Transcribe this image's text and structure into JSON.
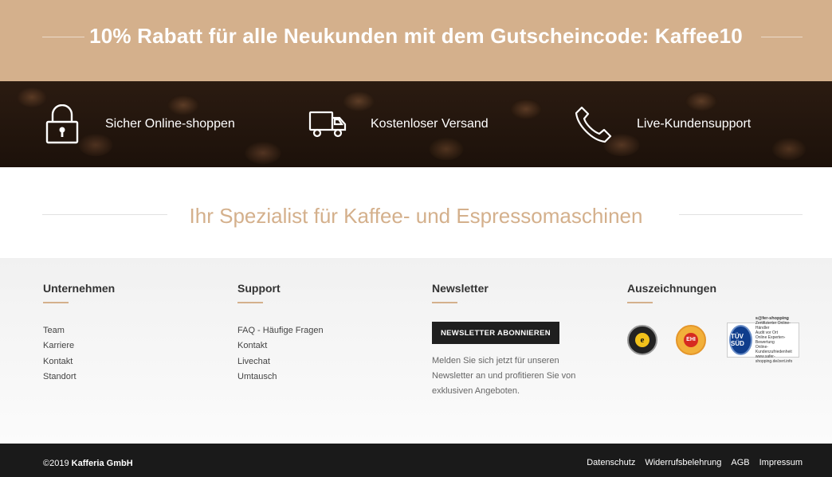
{
  "promo": {
    "text": "10% Rabatt für alle Neukunden mit dem Gutscheincode: Kaffee10"
  },
  "features": [
    {
      "icon": "lock-icon",
      "label": "Sicher Online-shoppen"
    },
    {
      "icon": "truck-icon",
      "label": "Kostenloser Versand"
    },
    {
      "icon": "phone-icon",
      "label": "Live-Kundensupport"
    }
  ],
  "tagline": {
    "text": "Ihr Spezialist für Kaffee- und Espressomaschinen"
  },
  "footer": {
    "company": {
      "title": "Unternehmen",
      "links": [
        "Team",
        "Karriere",
        "Kontakt",
        "Standort"
      ]
    },
    "support": {
      "title": "Support",
      "links": [
        "FAQ - Häufige Fragen",
        "Kontakt",
        "Livechat",
        "Umtausch"
      ]
    },
    "newsletter": {
      "title": "Newsletter",
      "button_label": "NEWSLETTER ABONNIEREN",
      "description": "Melden Sie sich jetzt für unseren Newsletter an und profitieren Sie von exklusiven Angeboten."
    },
    "awards": {
      "title": "Auszeichnungen",
      "items": [
        "trusted-shops-badge",
        "ehi-badge",
        "tuv-safer-shopping-badge"
      ],
      "trusted_shops_mark": "e",
      "ehi_mark": "EHI",
      "tuv_mark": "TÜV SÜD",
      "tuv_title": "s@fer-shopping",
      "tuv_lines": [
        "Zertifizierter Online-Händler",
        "Audit vor Ort",
        "Online Experten-Bewertung",
        "Online-Kundenzufriedenheit",
        "www.safer-shopping.de/zert.info"
      ]
    }
  },
  "bottom": {
    "copyright_prefix": "©2019",
    "company_name": "Kafferia GmbH",
    "links": [
      "Datenschutz",
      "Widerrufsbelehrung",
      "AGB",
      "Impressum"
    ]
  },
  "colors": {
    "accent": "#d4b08c",
    "dark": "#1a1a1a"
  }
}
